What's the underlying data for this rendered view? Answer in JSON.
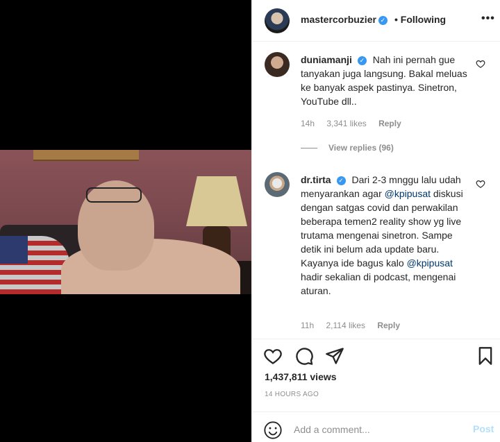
{
  "post": {
    "username": "mastercorbuzier",
    "verified": true,
    "follow_status": "• Following",
    "more_icon": "more-icon"
  },
  "comments": [
    {
      "username": "duniamanji",
      "verified": true,
      "text": "Nah ini pernah gue tanyakan juga langsung. Bakal meluas ke banyak aspek pastinya. Sinetron, YouTube dll..",
      "time": "14h",
      "likes": "3,341 likes",
      "reply": "Reply",
      "view_replies": "View replies (96)"
    },
    {
      "username": "dr.tirta",
      "verified": true,
      "text_before": "Dari 2-3 mnggu lalu udah menyarankan agar",
      "mention1": "@kpipusat",
      "text_middle": "diskusi dengan satgas covid dan perwakilan beberapa temen2 reality show yg live trutama mengenai sinetron. Sampe detik ini belum ada update baru. Kayanya ide bagus kalo",
      "mention2": "@kpipusat",
      "text_after": "hadir sekalian di podcast, mengenai aturan.",
      "time": "11h",
      "likes": "2,114 likes",
      "reply": "Reply"
    }
  ],
  "engagement": {
    "views": "1,437,811 views",
    "posted": "14 HOURS AGO"
  },
  "comment_box": {
    "placeholder": "Add a comment...",
    "post_label": "Post"
  },
  "colors": {
    "verified": "#3897f0",
    "secondary_text": "#8e8e8e",
    "mention": "#00376b",
    "post_disabled": "#b2dffc"
  }
}
